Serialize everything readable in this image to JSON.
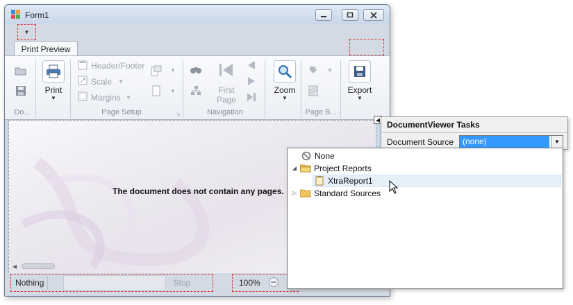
{
  "window": {
    "title": "Form1"
  },
  "ribbon": {
    "tab": "Print Preview",
    "groups": {
      "document": {
        "label": "Do..."
      },
      "print": {
        "print_label": "Print"
      },
      "page_setup": {
        "label": "Page Setup",
        "header_footer": "Header/Footer",
        "scale": "Scale",
        "margins": "Margins"
      },
      "navigation": {
        "label": "Navigation",
        "first_page_line1": "First",
        "first_page_line2": "Page"
      },
      "zoom": {
        "label": "Zoom"
      },
      "page_background": {
        "label": "Page B..."
      },
      "export": {
        "label": "Export"
      }
    }
  },
  "document": {
    "empty_message": "The document does not contain any pages."
  },
  "status_bar": {
    "status": "Nothing",
    "stop": "Stop",
    "zoom": "100%"
  },
  "tasks_panel": {
    "title": "DocumentViewer Tasks",
    "document_source_label": "Document Source",
    "document_source_value": "(none)"
  },
  "tree": {
    "none": "None",
    "project_reports": "Project Reports",
    "xtrareport1": "XtraReport1",
    "standard_sources": "Standard Sources"
  },
  "colors": {
    "selection": "#3399ff",
    "highlight": "#e5f0fb",
    "design_dash": "#d92f2f"
  }
}
